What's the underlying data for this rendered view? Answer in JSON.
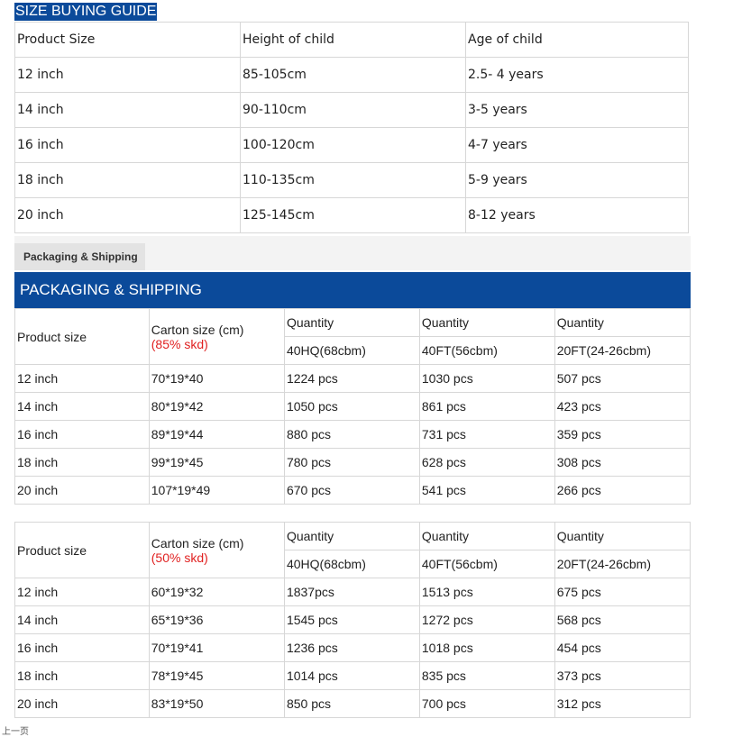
{
  "size_guide": {
    "title": "SIZE BUYING GUIDE",
    "headers": [
      "Product Size",
      "Height of child",
      "Age of child"
    ],
    "rows": [
      [
        "12 inch",
        "85-105cm",
        "2.5- 4 years"
      ],
      [
        "14 inch",
        "90-110cm",
        "3-5 years"
      ],
      [
        "16 inch",
        "100-120cm",
        "4-7 years"
      ],
      [
        "18 inch",
        "110-135cm",
        "5-9 years"
      ],
      [
        "20 inch",
        "125-145cm",
        "8-12 years"
      ]
    ]
  },
  "tab": {
    "label": "Packaging & Shipping"
  },
  "shipping_header": {
    "title": "PACKAGING & SHIPPING"
  },
  "packing_tables": [
    {
      "product_size_label": "Product size",
      "carton_label": "Carton size (cm)",
      "carton_note": "(85% skd)",
      "quantity_label": "Quantity",
      "containers": [
        "40HQ(68cbm)",
        "40FT(56cbm)",
        "20FT(24-26cbm)"
      ],
      "rows": [
        [
          "12 inch",
          "70*19*40",
          "1224 pcs",
          "1030 pcs",
          "507 pcs"
        ],
        [
          "14 inch",
          "80*19*42",
          "1050 pcs",
          "861 pcs",
          "423 pcs"
        ],
        [
          "16 inch",
          "89*19*44",
          "880 pcs",
          "731 pcs",
          "359 pcs"
        ],
        [
          "18 inch",
          "99*19*45",
          "780 pcs",
          "628 pcs",
          "308 pcs"
        ],
        [
          "20 inch",
          "107*19*49",
          "670 pcs",
          "541 pcs",
          "266 pcs"
        ]
      ]
    },
    {
      "product_size_label": "Product size",
      "carton_label": "Carton size (cm)",
      "carton_note": "(50% skd)",
      "quantity_label": "Quantity",
      "containers": [
        "40HQ(68cbm)",
        "40FT(56cbm)",
        "20FT(24-26cbm)"
      ],
      "rows": [
        [
          "12 inch",
          "60*19*32",
          "1837pcs",
          "1513 pcs",
          "675 pcs"
        ],
        [
          "14 inch",
          "65*19*36",
          "1545 pcs",
          "1272 pcs",
          "568 pcs"
        ],
        [
          "16 inch",
          "70*19*41",
          "1236 pcs",
          "1018 pcs",
          "454 pcs"
        ],
        [
          "18 inch",
          "78*19*45",
          "1014 pcs",
          "835 pcs",
          "373 pcs"
        ],
        [
          "20 inch",
          "83*19*50",
          "850 pcs",
          "700 pcs",
          "312 pcs"
        ]
      ]
    }
  ],
  "footer": {
    "text": "上一页"
  }
}
